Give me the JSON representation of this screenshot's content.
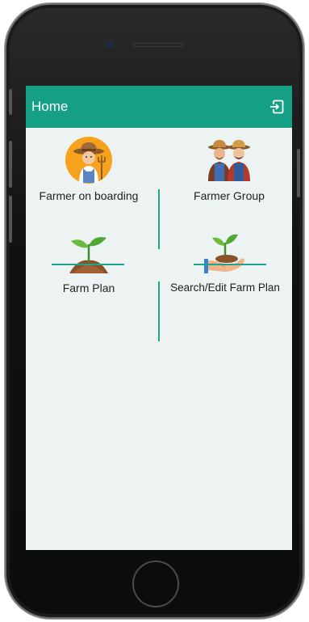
{
  "appbar": {
    "title": "Home",
    "logout_icon": "logout-icon"
  },
  "tiles": [
    {
      "label": "Farmer on boarding",
      "icon": "farmer-icon"
    },
    {
      "label": "Farmer Group",
      "icon": "farmer-group-icon"
    },
    {
      "label": "Farm Plan",
      "icon": "sprout-icon"
    },
    {
      "label": "Search/Edit Farm Plan",
      "icon": "hand-plant-icon"
    }
  ],
  "colors": {
    "accent": "#15a085",
    "screen_background": "#edf3f3",
    "label_text": "#222222"
  }
}
